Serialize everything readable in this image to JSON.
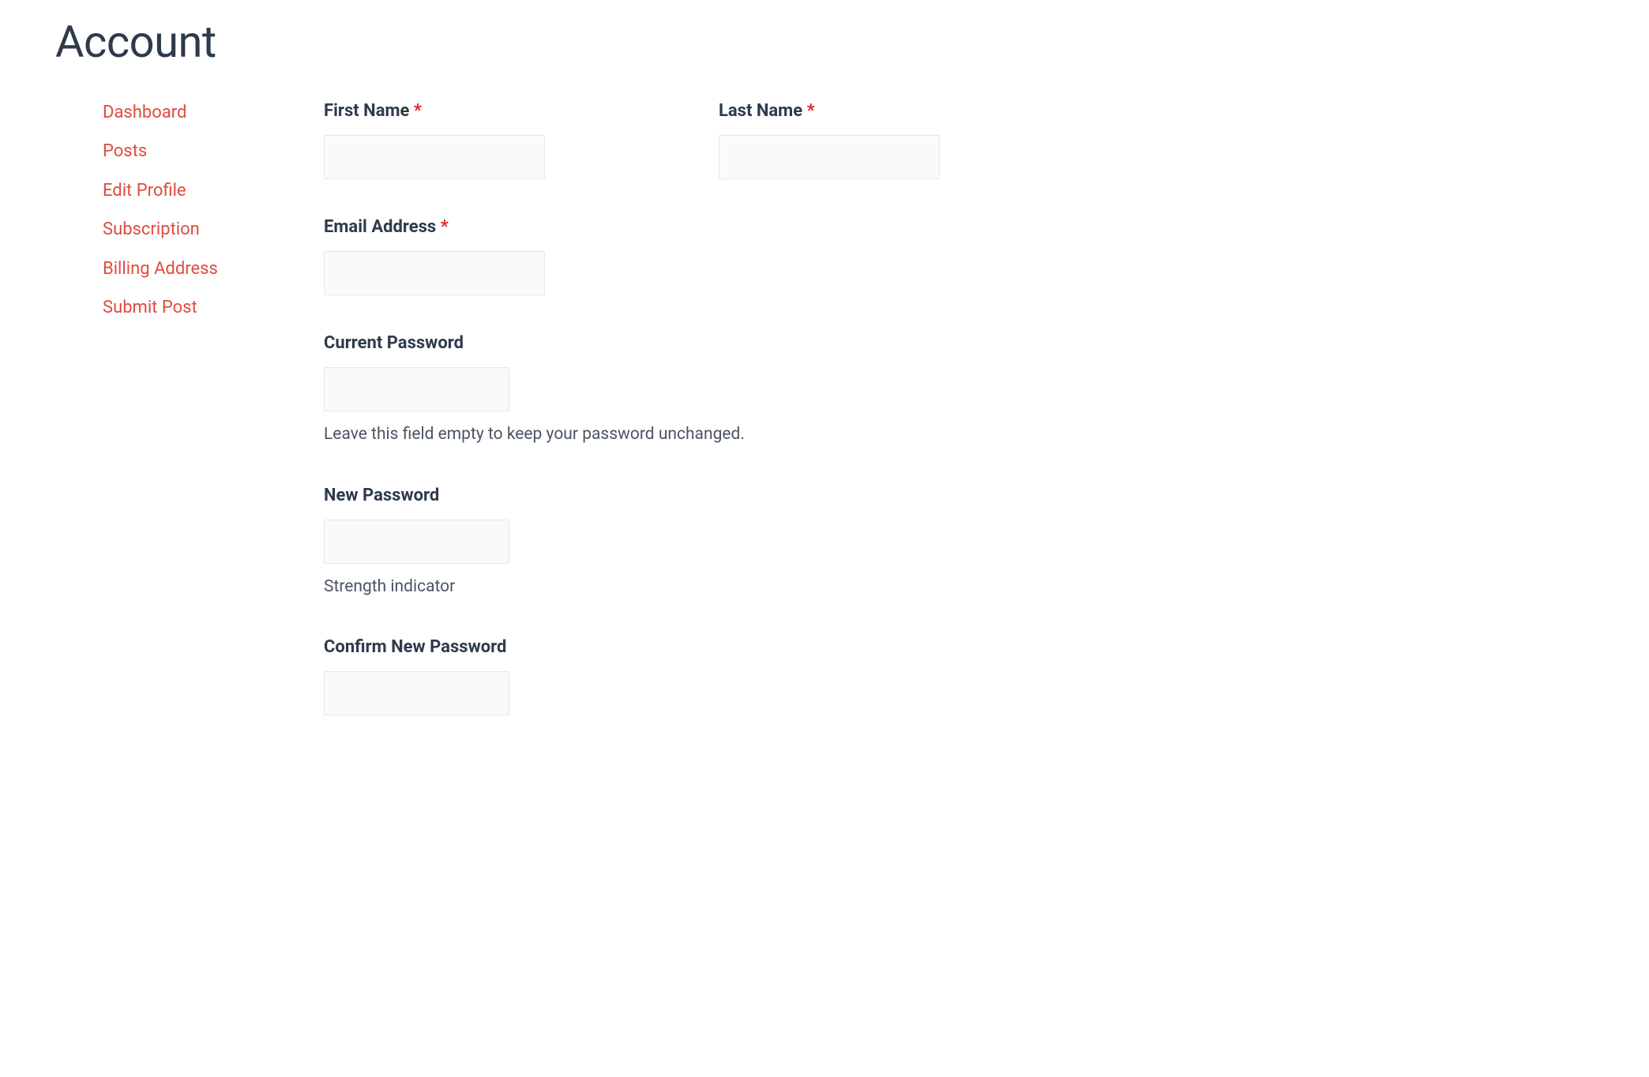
{
  "page_title": "Account",
  "sidebar": {
    "items": [
      {
        "label": "Dashboard"
      },
      {
        "label": "Posts"
      },
      {
        "label": "Edit Profile"
      },
      {
        "label": "Subscription"
      },
      {
        "label": "Billing Address"
      },
      {
        "label": "Submit Post"
      }
    ]
  },
  "form": {
    "first_name": {
      "label": "First Name",
      "required": "*",
      "value": ""
    },
    "last_name": {
      "label": "Last Name",
      "required": "*",
      "value": ""
    },
    "email": {
      "label": "Email Address",
      "required": "*",
      "value": ""
    },
    "current_password": {
      "label": "Current Password",
      "help": "Leave this field empty to keep your password unchanged.",
      "value": ""
    },
    "new_password": {
      "label": "New Password",
      "help": "Strength indicator",
      "value": ""
    },
    "confirm_password": {
      "label": "Confirm New Password",
      "value": ""
    }
  }
}
